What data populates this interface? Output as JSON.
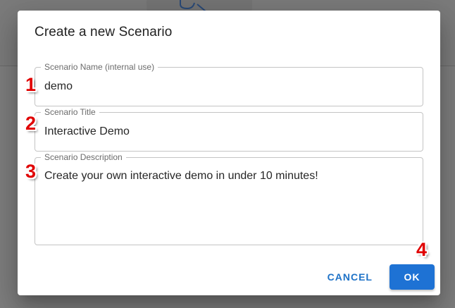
{
  "dialog": {
    "title": "Create a new Scenario",
    "fields": {
      "name": {
        "label": "Scenario Name (internal use)",
        "value": "demo"
      },
      "title": {
        "label": "Scenario Title",
        "value": "Interactive Demo"
      },
      "description": {
        "label": "Scenario Description",
        "value": "Create your own interactive demo in under 10 minutes!"
      }
    },
    "actions": {
      "cancel_label": "CANCEL",
      "ok_label": "OK"
    }
  },
  "annotations": [
    "1",
    "2",
    "3",
    "4"
  ],
  "colors": {
    "primary": "#1e72d4",
    "annotation": "#e00000",
    "overlay": "#7e7e7e"
  },
  "icons": {
    "background_icon": "search-icon"
  }
}
